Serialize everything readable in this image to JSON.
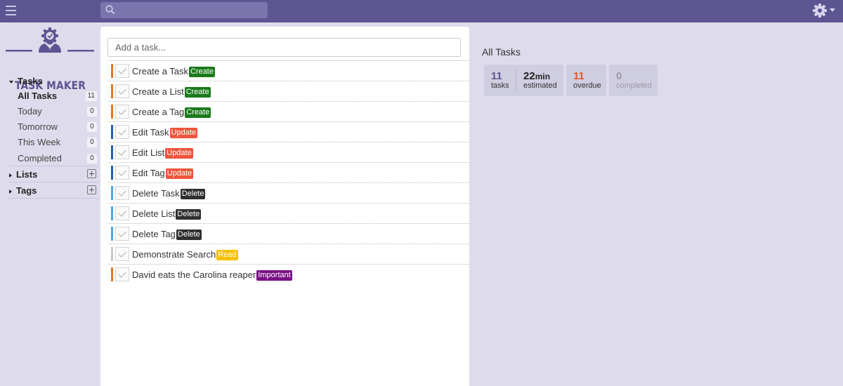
{
  "app": {
    "name": "TASK MAKER",
    "search_placeholder": ""
  },
  "sidebar": {
    "tasks_label": "Tasks",
    "items": [
      {
        "label": "All Tasks",
        "count": "11"
      },
      {
        "label": "Today",
        "count": "0"
      },
      {
        "label": "Tomorrow",
        "count": "0"
      },
      {
        "label": "This Week",
        "count": "0"
      },
      {
        "label": "Completed",
        "count": "0"
      }
    ],
    "lists_label": "Lists",
    "tags_label": "Tags"
  },
  "main": {
    "add_placeholder": "Add a task...",
    "tasks": [
      {
        "title": "Create a Task",
        "tag": "Create"
      },
      {
        "title": "Create a List",
        "tag": "Create"
      },
      {
        "title": "Create a Tag",
        "tag": "Create"
      },
      {
        "title": "Edit Task",
        "tag": "Update"
      },
      {
        "title": "Edit List",
        "tag": "Update"
      },
      {
        "title": "Edit Tag",
        "tag": "Update"
      },
      {
        "title": "Delete Task",
        "tag": "Delete"
      },
      {
        "title": "Delete List",
        "tag": "Delete"
      },
      {
        "title": "Delete Tag",
        "tag": "Delete"
      },
      {
        "title": "Demonstrate Search",
        "tag": "Read"
      },
      {
        "title": "David eats the Carolina reaper",
        "tag": "Important"
      }
    ]
  },
  "stats": {
    "title": "All Tasks",
    "tasks_num": "11",
    "tasks_cap": "tasks",
    "est_num": "22",
    "est_unit": "min",
    "est_cap": "estimated",
    "overdue_num": "11",
    "overdue_cap": "overdue",
    "completed_num": "0",
    "completed_cap": "completed"
  },
  "colors": {
    "topbar": "#5c5591",
    "tag_create": "#1a7a1a",
    "tag_update": "#f0543c",
    "tag_delete": "#2f2f2f",
    "tag_read": "#f5c000",
    "tag_important": "#7b1287",
    "priority_high": "#e8761e",
    "priority_medium": "#1d5fb4",
    "priority_low": "#4ea7e8",
    "priority_none": "#c8c8c8",
    "overdue": "#e05a2a"
  }
}
